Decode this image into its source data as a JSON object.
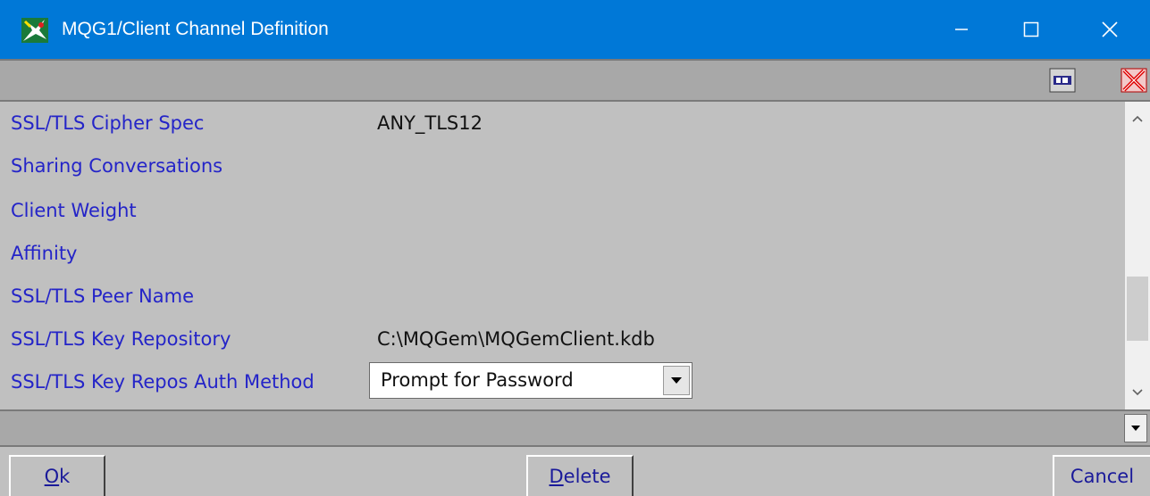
{
  "window": {
    "title": "MQG1/Client Channel Definition",
    "minimize_icon": "minimize-icon",
    "maximize_icon": "maximize-icon",
    "close_icon": "close-icon"
  },
  "toolbar": {
    "ok_icon": "ok-icon",
    "cancel_icon": "red-x-icon"
  },
  "fields": [
    {
      "label": "SSL/TLS Cipher Spec",
      "value": "ANY_TLS12"
    },
    {
      "label": "Sharing Conversations",
      "value": ""
    },
    {
      "label": "Client Weight",
      "value": ""
    },
    {
      "label": "Affinity",
      "value": ""
    },
    {
      "label": "SSL/TLS Peer Name",
      "value": ""
    },
    {
      "label": "SSL/TLS Key Repository",
      "value": "C:\\MQGem\\MQGemClient.kdb"
    },
    {
      "label": "SSL/TLS Key Repos Auth Method",
      "value": "Prompt for Password"
    }
  ],
  "buttons": {
    "ok": {
      "mnemonic": "O",
      "rest": "k"
    },
    "delete": {
      "mnemonic": "D",
      "rest": "elete"
    },
    "cancel": {
      "label": "Cancel"
    }
  },
  "colors": {
    "titlebar": "#0078d7",
    "label_text": "#2424c8",
    "background": "#c0c0c0"
  }
}
